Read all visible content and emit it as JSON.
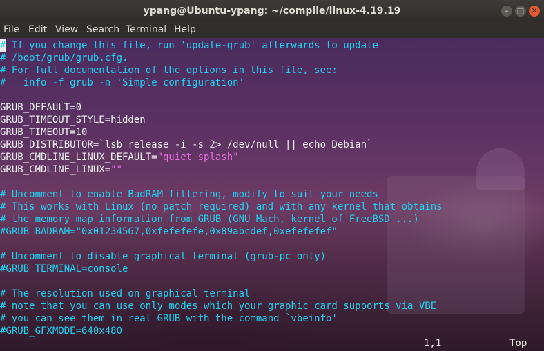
{
  "window": {
    "title": "ypang@Ubuntu-ypang: ~/compile/linux-4.19.19",
    "minimize_glyph": "–",
    "maximize_glyph": "□",
    "close_glyph": "✕"
  },
  "menu": [
    "File",
    "Edit",
    "View",
    "Search",
    "Terminal",
    "Help"
  ],
  "editor": {
    "lines": [
      "# If you change this file, run 'update-grub' afterwards to update",
      "# /boot/grub/grub.cfg.",
      "# For full documentation of the options in this file, see:",
      "#   info -f grub -n 'Simple configuration'",
      "",
      "GRUB_DEFAULT=0",
      "GRUB_TIMEOUT_STYLE=hidden",
      "GRUB_TIMEOUT=10",
      "GRUB_DISTRIBUTOR=`lsb_release -i -s 2> /dev/null || echo Debian`",
      {
        "prefix": "GRUB_CMDLINE_LINUX_DEFAULT=",
        "string": "\"quiet splash\""
      },
      {
        "prefix": "GRUB_CMDLINE_LINUX=",
        "string": "\"\""
      },
      "",
      "# Uncomment to enable BadRAM filtering, modify to suit your needs",
      "# This works with Linux (no patch required) and with any kernel that obtains",
      "# the memory map information from GRUB (GNU Mach, kernel of FreeBSD ...)",
      "#GRUB_BADRAM=\"0x01234567,0xfefefefe,0x89abcdef,0xefefefef\"",
      "",
      "# Uncomment to disable graphical terminal (grub-pc only)",
      "#GRUB_TERMINAL=console",
      "",
      "# The resolution used on graphical terminal",
      "# note that you can use only modes which your graphic card supports via VBE",
      "# you can see them in real GRUB with the command `vbeinfo'",
      "#GRUB_GFXMODE=640x480"
    ]
  },
  "status": {
    "position": "1,1",
    "scroll": "Top"
  },
  "colors": {
    "comment": "#1fd2f2",
    "string": "#e86ee0",
    "text": "#f2f2f2",
    "titlebar": "#3a3935",
    "close_button": "#e9582d"
  }
}
